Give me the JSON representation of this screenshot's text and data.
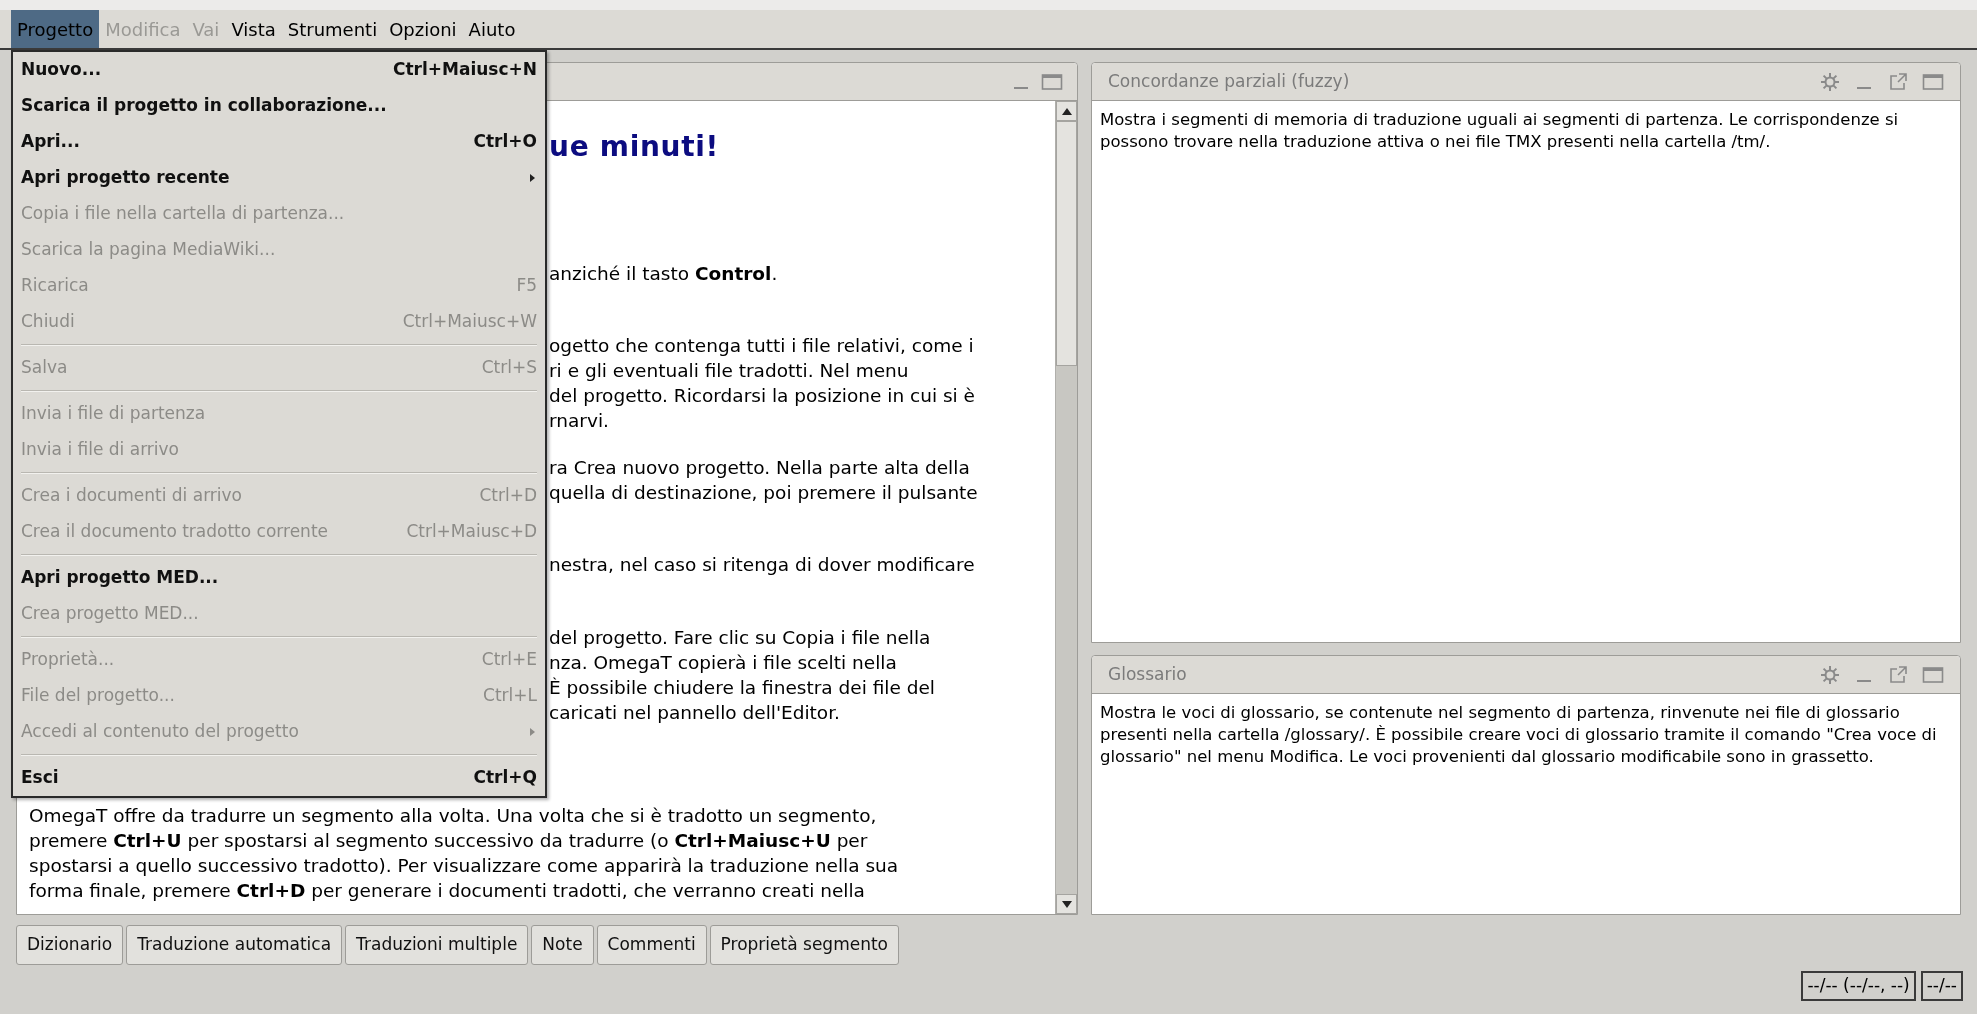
{
  "menu_bar": [
    {
      "label": "Progetto",
      "selected": true,
      "disabled": false
    },
    {
      "label": "Modifica",
      "selected": false,
      "disabled": true
    },
    {
      "label": "Vai",
      "selected": false,
      "disabled": true
    },
    {
      "label": "Vista",
      "selected": false,
      "disabled": false
    },
    {
      "label": "Strumenti",
      "selected": false,
      "disabled": false
    },
    {
      "label": "Opzioni",
      "selected": false,
      "disabled": false
    },
    {
      "label": "Aiuto",
      "selected": false,
      "disabled": false
    }
  ],
  "menu": [
    {
      "kind": "item",
      "label": "Nuovo...",
      "shortcut": "Ctrl+Maiusc+N",
      "disabled": false
    },
    {
      "kind": "item",
      "label": "Scarica il progetto in collaborazione...",
      "disabled": false
    },
    {
      "kind": "item",
      "label": "Apri...",
      "shortcut": "Ctrl+O",
      "disabled": false
    },
    {
      "kind": "submenu",
      "label": "Apri progetto recente",
      "disabled": false
    },
    {
      "kind": "item",
      "label": "Copia i file nella cartella di partenza...",
      "disabled": true
    },
    {
      "kind": "item",
      "label": "Scarica la pagina MediaWiki...",
      "disabled": true
    },
    {
      "kind": "item",
      "label": "Ricarica",
      "shortcut": "F5",
      "disabled": true
    },
    {
      "kind": "item",
      "label": "Chiudi",
      "shortcut": "Ctrl+Maiusc+W",
      "disabled": true
    },
    {
      "kind": "separator"
    },
    {
      "kind": "item",
      "label": "Salva",
      "shortcut": "Ctrl+S",
      "disabled": true
    },
    {
      "kind": "separator"
    },
    {
      "kind": "item",
      "label": "Invia i file di partenza",
      "disabled": true
    },
    {
      "kind": "item",
      "label": "Invia i file di arrivo",
      "disabled": true
    },
    {
      "kind": "separator"
    },
    {
      "kind": "item",
      "label": "Crea i documenti di arrivo",
      "shortcut": "Ctrl+D",
      "disabled": true
    },
    {
      "kind": "item",
      "label": "Crea il documento tradotto corrente",
      "shortcut": "Ctrl+Maiusc+D",
      "disabled": true
    },
    {
      "kind": "separator"
    },
    {
      "kind": "item",
      "label": "Apri progetto MED...",
      "disabled": false
    },
    {
      "kind": "item",
      "label": "Crea progetto MED...",
      "disabled": true
    },
    {
      "kind": "separator"
    },
    {
      "kind": "item",
      "label": "Proprietà...",
      "shortcut": "Ctrl+E",
      "disabled": true
    },
    {
      "kind": "item",
      "label": "File del progetto...",
      "shortcut": "Ctrl+L",
      "disabled": true
    },
    {
      "kind": "submenu",
      "label": "Accedi al contenuto del progetto",
      "disabled": true
    },
    {
      "kind": "separator"
    },
    {
      "kind": "item",
      "label": "Esci",
      "shortcut": "Ctrl+Q",
      "disabled": false
    }
  ],
  "editor": {
    "blocks": [
      {
        "kind": "heading",
        "clipped": true,
        "lines": [
          "ue minuti!"
        ]
      },
      {
        "kind": "para",
        "clipped": true,
        "lines": [
          "anziché il tasto **Control**."
        ]
      },
      {
        "kind": "para",
        "clipped": true,
        "lines": [
          "ogetto che contenga tutti i file relativi, come i",
          "ri e gli eventuali file tradotti. Nel menu",
          "del progetto. Ricordarsi la posizione in cui si è",
          "rnarvi."
        ]
      },
      {
        "kind": "para",
        "clipped": true,
        "lines": [
          "ra Crea nuovo progetto. Nella parte alta della",
          "quella di destinazione, poi premere il pulsante"
        ]
      },
      {
        "kind": "para",
        "clipped": true,
        "lines": [
          "nestra, nel caso si ritenga di dover modificare"
        ]
      },
      {
        "kind": "para",
        "clipped": true,
        "lines": [
          "del progetto. Fare clic su Copia i file nella",
          "nza. OmegaT copierà i file scelti nella",
          "È possibile chiudere la finestra dei file del",
          "caricati nel pannello dell'Editor."
        ]
      },
      {
        "kind": "para",
        "clipped": false,
        "lines": [
          "OmegaT offre da tradurre un segmento alla volta. Una volta che si è tradotto un segmento,",
          "premere **Ctrl+U** per spostarsi al segmento successivo da tradurre (o **Ctrl+Maiusc+U** per",
          "spostarsi a quello successivo tradotto). Per visualizzare come apparirà la traduzione nella sua",
          "forma finale, premere **Ctrl+D** per generare i documenti tradotti, che verranno creati nella"
        ]
      }
    ]
  },
  "panes": [
    {
      "title": "Concordanze parziali (fuzzy)",
      "text": "Mostra i segmenti di memoria di traduzione uguali ai segmenti di partenza. Le corrispondenze si possono trovare nella traduzione attiva o nei file TMX presenti nella cartella /tm/."
    },
    {
      "title": "Glossario",
      "text": "Mostra le voci di glossario, se contenute nel segmento di partenza, rinvenute nei file di glossario presenti nella cartella /glossary/. È possibile creare voci di glossario tramite il comando \"Crea voce di glossario\" nel menu Modifica. Le voci provenienti dal glossario modificabile sono in grassetto."
    }
  ],
  "bottom_tabs": [
    "Dizionario",
    "Traduzione automatica",
    "Traduzioni multiple",
    "Note",
    "Commenti",
    "Proprietà segmento"
  ],
  "status_bar": [
    "--/-- (--/--, --)",
    "--/--"
  ]
}
